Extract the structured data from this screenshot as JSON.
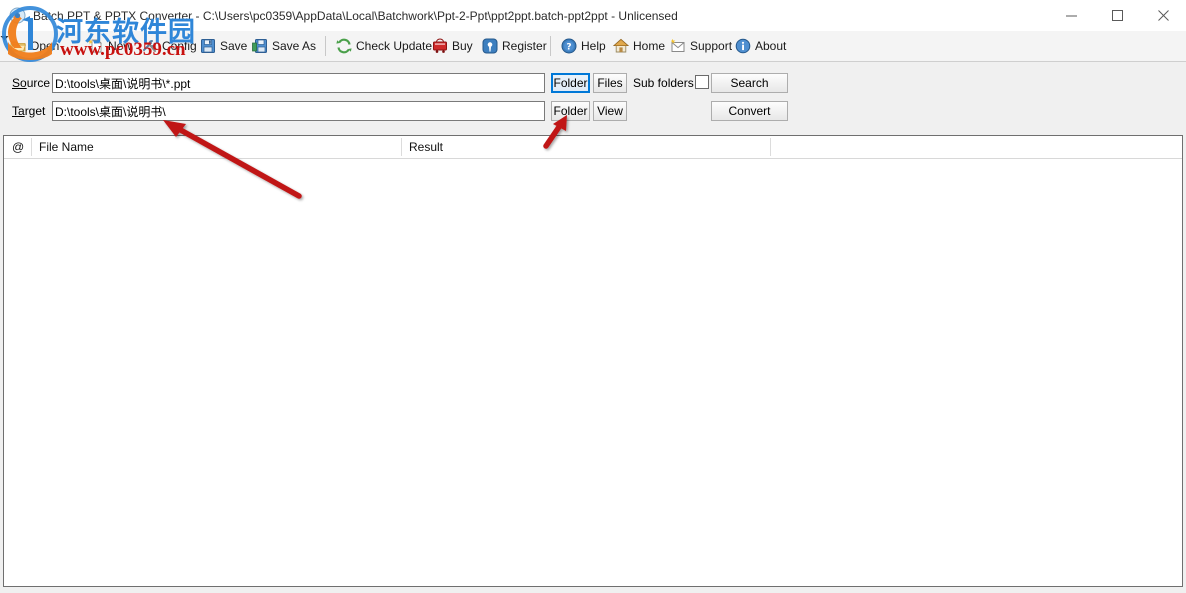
{
  "window": {
    "title": "Batch PPT & PPTX Converter - C:\\Users\\pc0359\\AppData\\Local\\Batchwork\\Ppt-2-Ppt\\ppt2ppt.batch-ppt2ppt - Unlicensed",
    "icon": "app-icon",
    "controls": {
      "minimize": "—",
      "maximize": "□",
      "close": "✕"
    }
  },
  "toolbar": {
    "open_label": "Open",
    "open_dropdown": "chevron-down-icon",
    "new_label": "New",
    "config_label": "Config",
    "save_label": "Save",
    "save_as_label": "Save As",
    "check_update_label": "Check Update",
    "buy_label": "Buy",
    "register_label": "Register",
    "help_label": "Help",
    "home_label": "Home",
    "support_label": "Support",
    "about_label": "About"
  },
  "form": {
    "source": {
      "label": "Source",
      "label_mnemonic": "So",
      "label_rest": "urce",
      "value": "D:\\tools\\桌面\\说明书\\*.ppt",
      "placeholder": "",
      "folder_button": "Folder",
      "files_button": "Files",
      "folder_focused": true,
      "sub_folders_label": "Sub folders",
      "sub_folders_checked": false,
      "search_button": "Search"
    },
    "target": {
      "label": "Target",
      "label_mnemonic": "Ta",
      "label_rest": "rget",
      "value": "D:\\tools\\桌面\\说明书\\",
      "placeholder": "",
      "folder_button": "Folder",
      "view_button": "View",
      "convert_button": "Convert"
    }
  },
  "list": {
    "columns": [
      {
        "key": "at",
        "label": "@"
      },
      {
        "key": "file_name",
        "label": "File Name"
      },
      {
        "key": "result",
        "label": "Result"
      }
    ],
    "rows": []
  },
  "watermark": {
    "site_name": "河东软件园",
    "site_url": "www.pc0359.cn",
    "logo": "hedong-logo-icon",
    "colors": {
      "site_name": "#2f86d8",
      "site_url": "#c8110f",
      "logo_orange": "#f07d1a",
      "logo_blue": "#2f86d8"
    }
  },
  "annotations": {
    "arrow_color": "#c01515",
    "arrow_target_path": "points-to-target-input",
    "arrow_target_folder": "points-to-target-folder-button"
  },
  "theme": {
    "accent": "#0078d7",
    "toolbar_bg": "#f4f4f4",
    "window_bg": "#f0f0f0",
    "border": "#6f6f6f"
  }
}
